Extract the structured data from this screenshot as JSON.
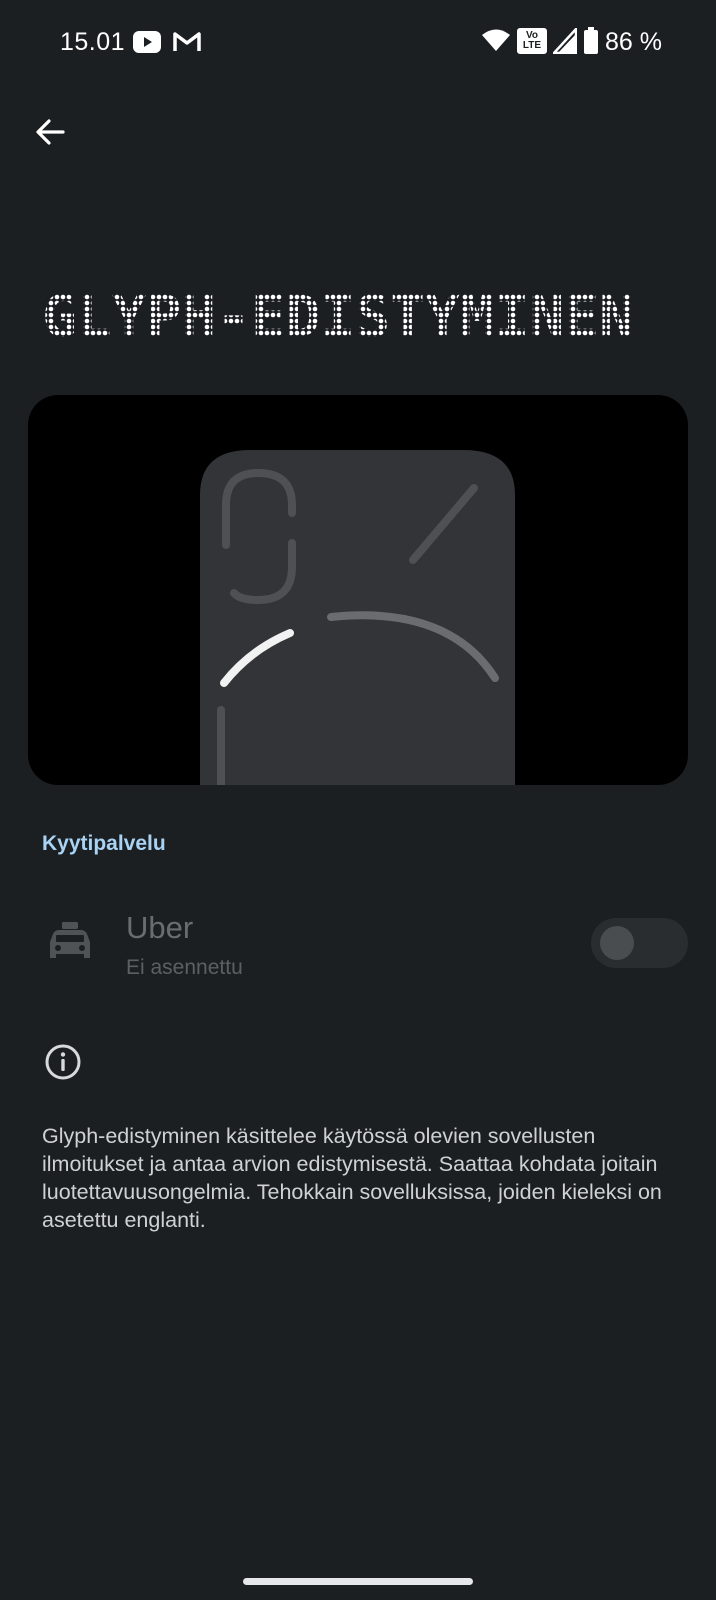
{
  "status_bar": {
    "time": "15.01",
    "volte_label_top": "Vo",
    "volte_label_bottom": "LTE",
    "battery": "86 %"
  },
  "navigation": {
    "back_icon": "arrow-left-icon"
  },
  "page": {
    "title": "GLYPH-EDISTYMINEN"
  },
  "section": {
    "header": "Kyytipalvelu"
  },
  "app_item": {
    "name": "Uber",
    "status": "Ei asennettu",
    "icon": "taxi-icon",
    "enabled": false
  },
  "info": {
    "icon": "info-icon",
    "text": "Glyph-edistyminen käsittelee käytössä olevien sovellusten ilmoitukset ja antaa arvion edistymisestä. Saattaa kohdata joitain luotettavuusongelmia. Tehokkain sovelluksissa, joiden kieleksi on asetettu englanti."
  },
  "colors": {
    "background": "#1c1f22",
    "accent": "#a9d3f5"
  }
}
